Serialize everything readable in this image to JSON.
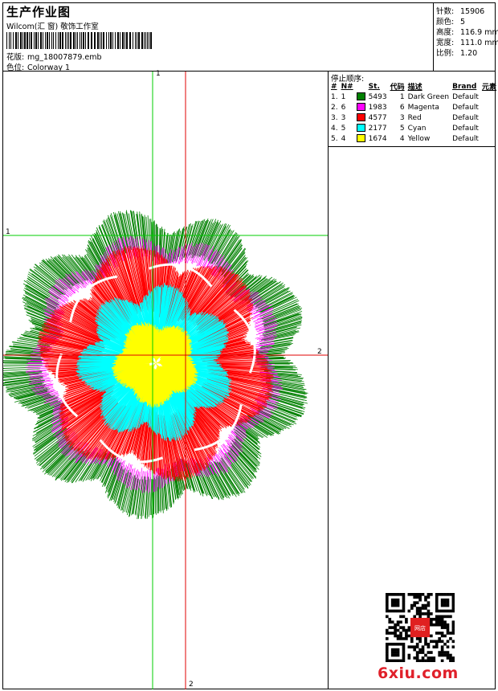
{
  "header": {
    "title": "生产作业图",
    "studio": "Wilcom(汇 窗) 敬饰工作室",
    "design_label": "花版:",
    "design_value": "mg_18007879.emb",
    "colorway_label": "色位:",
    "colorway_value": "Colorway 1"
  },
  "stats": [
    {
      "label": "针数:",
      "value": "15906"
    },
    {
      "label": "颜色:",
      "value": "5"
    },
    {
      "label": "高度:",
      "value": "116.9 mm"
    },
    {
      "label": "宽度:",
      "value": "111.0 mm"
    },
    {
      "label": "比例:",
      "value": "1.20"
    }
  ],
  "stop_sequence": {
    "title": "停止顺序:",
    "columns": [
      "#",
      "N#",
      "St.",
      "代码",
      "描述",
      "Brand",
      "元素"
    ],
    "rows": [
      {
        "idx": "1.",
        "n": "1",
        "color": "#008000",
        "st": "5493",
        "code": "1",
        "desc": "Dark Green",
        "brand": "Default"
      },
      {
        "idx": "2.",
        "n": "6",
        "color": "#ff00ff",
        "st": "1983",
        "code": "6",
        "desc": "Magenta",
        "brand": "Default"
      },
      {
        "idx": "3.",
        "n": "3",
        "color": "#ff0000",
        "st": "4577",
        "code": "3",
        "desc": "Red",
        "brand": "Default"
      },
      {
        "idx": "4.",
        "n": "5",
        "color": "#00ffff",
        "st": "2177",
        "code": "5",
        "desc": "Cyan",
        "brand": "Default"
      },
      {
        "idx": "5.",
        "n": "4",
        "color": "#ffff00",
        "st": "1674",
        "code": "4",
        "desc": "Yellow",
        "brand": "Default"
      }
    ]
  },
  "guides": {
    "top": "1",
    "left": "1",
    "right": "2",
    "bottom": "2"
  },
  "watermark": {
    "logo": "6xiu.com",
    "qr_stamp": "网店"
  },
  "colors": {
    "dark_green": "#008000",
    "magenta": "#ff00ff",
    "red": "#ff0000",
    "cyan": "#00ffff",
    "yellow": "#ffff00",
    "guide_green": "#00cc00",
    "guide_red": "#e00000",
    "logo_red": "#e0202a"
  }
}
